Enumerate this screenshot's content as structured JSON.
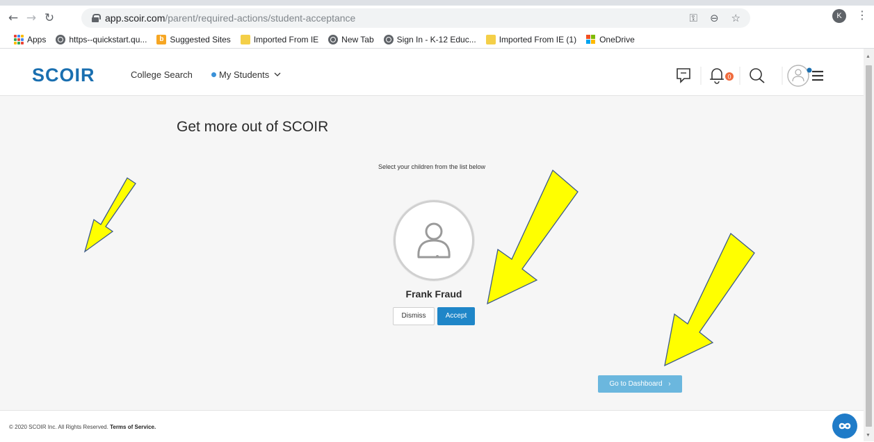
{
  "browser": {
    "url_host": "app.scoir.com",
    "url_path": "/parent/required-actions/student-acceptance",
    "profile_initial": "K",
    "bookmarks": [
      {
        "label": "Apps",
        "icon": "apps-grid-icon"
      },
      {
        "label": "https--quickstart.qu...",
        "icon": "globe-icon"
      },
      {
        "label": "Suggested Sites",
        "icon": "bing-icon"
      },
      {
        "label": "Imported From IE",
        "icon": "folder-icon"
      },
      {
        "label": "New Tab",
        "icon": "globe-icon"
      },
      {
        "label": "Sign In - K-12 Educ...",
        "icon": "globe-icon"
      },
      {
        "label": "Imported From IE (1)",
        "icon": "folder-icon"
      },
      {
        "label": "OneDrive",
        "icon": "microsoft-icon"
      }
    ]
  },
  "header": {
    "logo": "SCOIR",
    "nav": {
      "college_search": "College Search",
      "my_students": "My Students"
    },
    "notification_count": "0",
    "colors": {
      "brand": "#1a6fb0",
      "badge": "#f06b3c"
    }
  },
  "main": {
    "title": "Get more out of SCOIR",
    "subtitle": "Select your children from the list below",
    "student": {
      "name": "Frank Fraud",
      "dismiss_label": "Dismiss",
      "accept_label": "Accept"
    },
    "dashboard_label": "Go to Dashboard",
    "dashboard_chevron": "›"
  },
  "footer": {
    "copyright": "© 2020 SCOIR Inc. All Rights Reserved.",
    "terms": "Terms of Service."
  },
  "annotations": {
    "arrow_color": "#ffff00",
    "arrow_outline": "#3c5a8a"
  }
}
